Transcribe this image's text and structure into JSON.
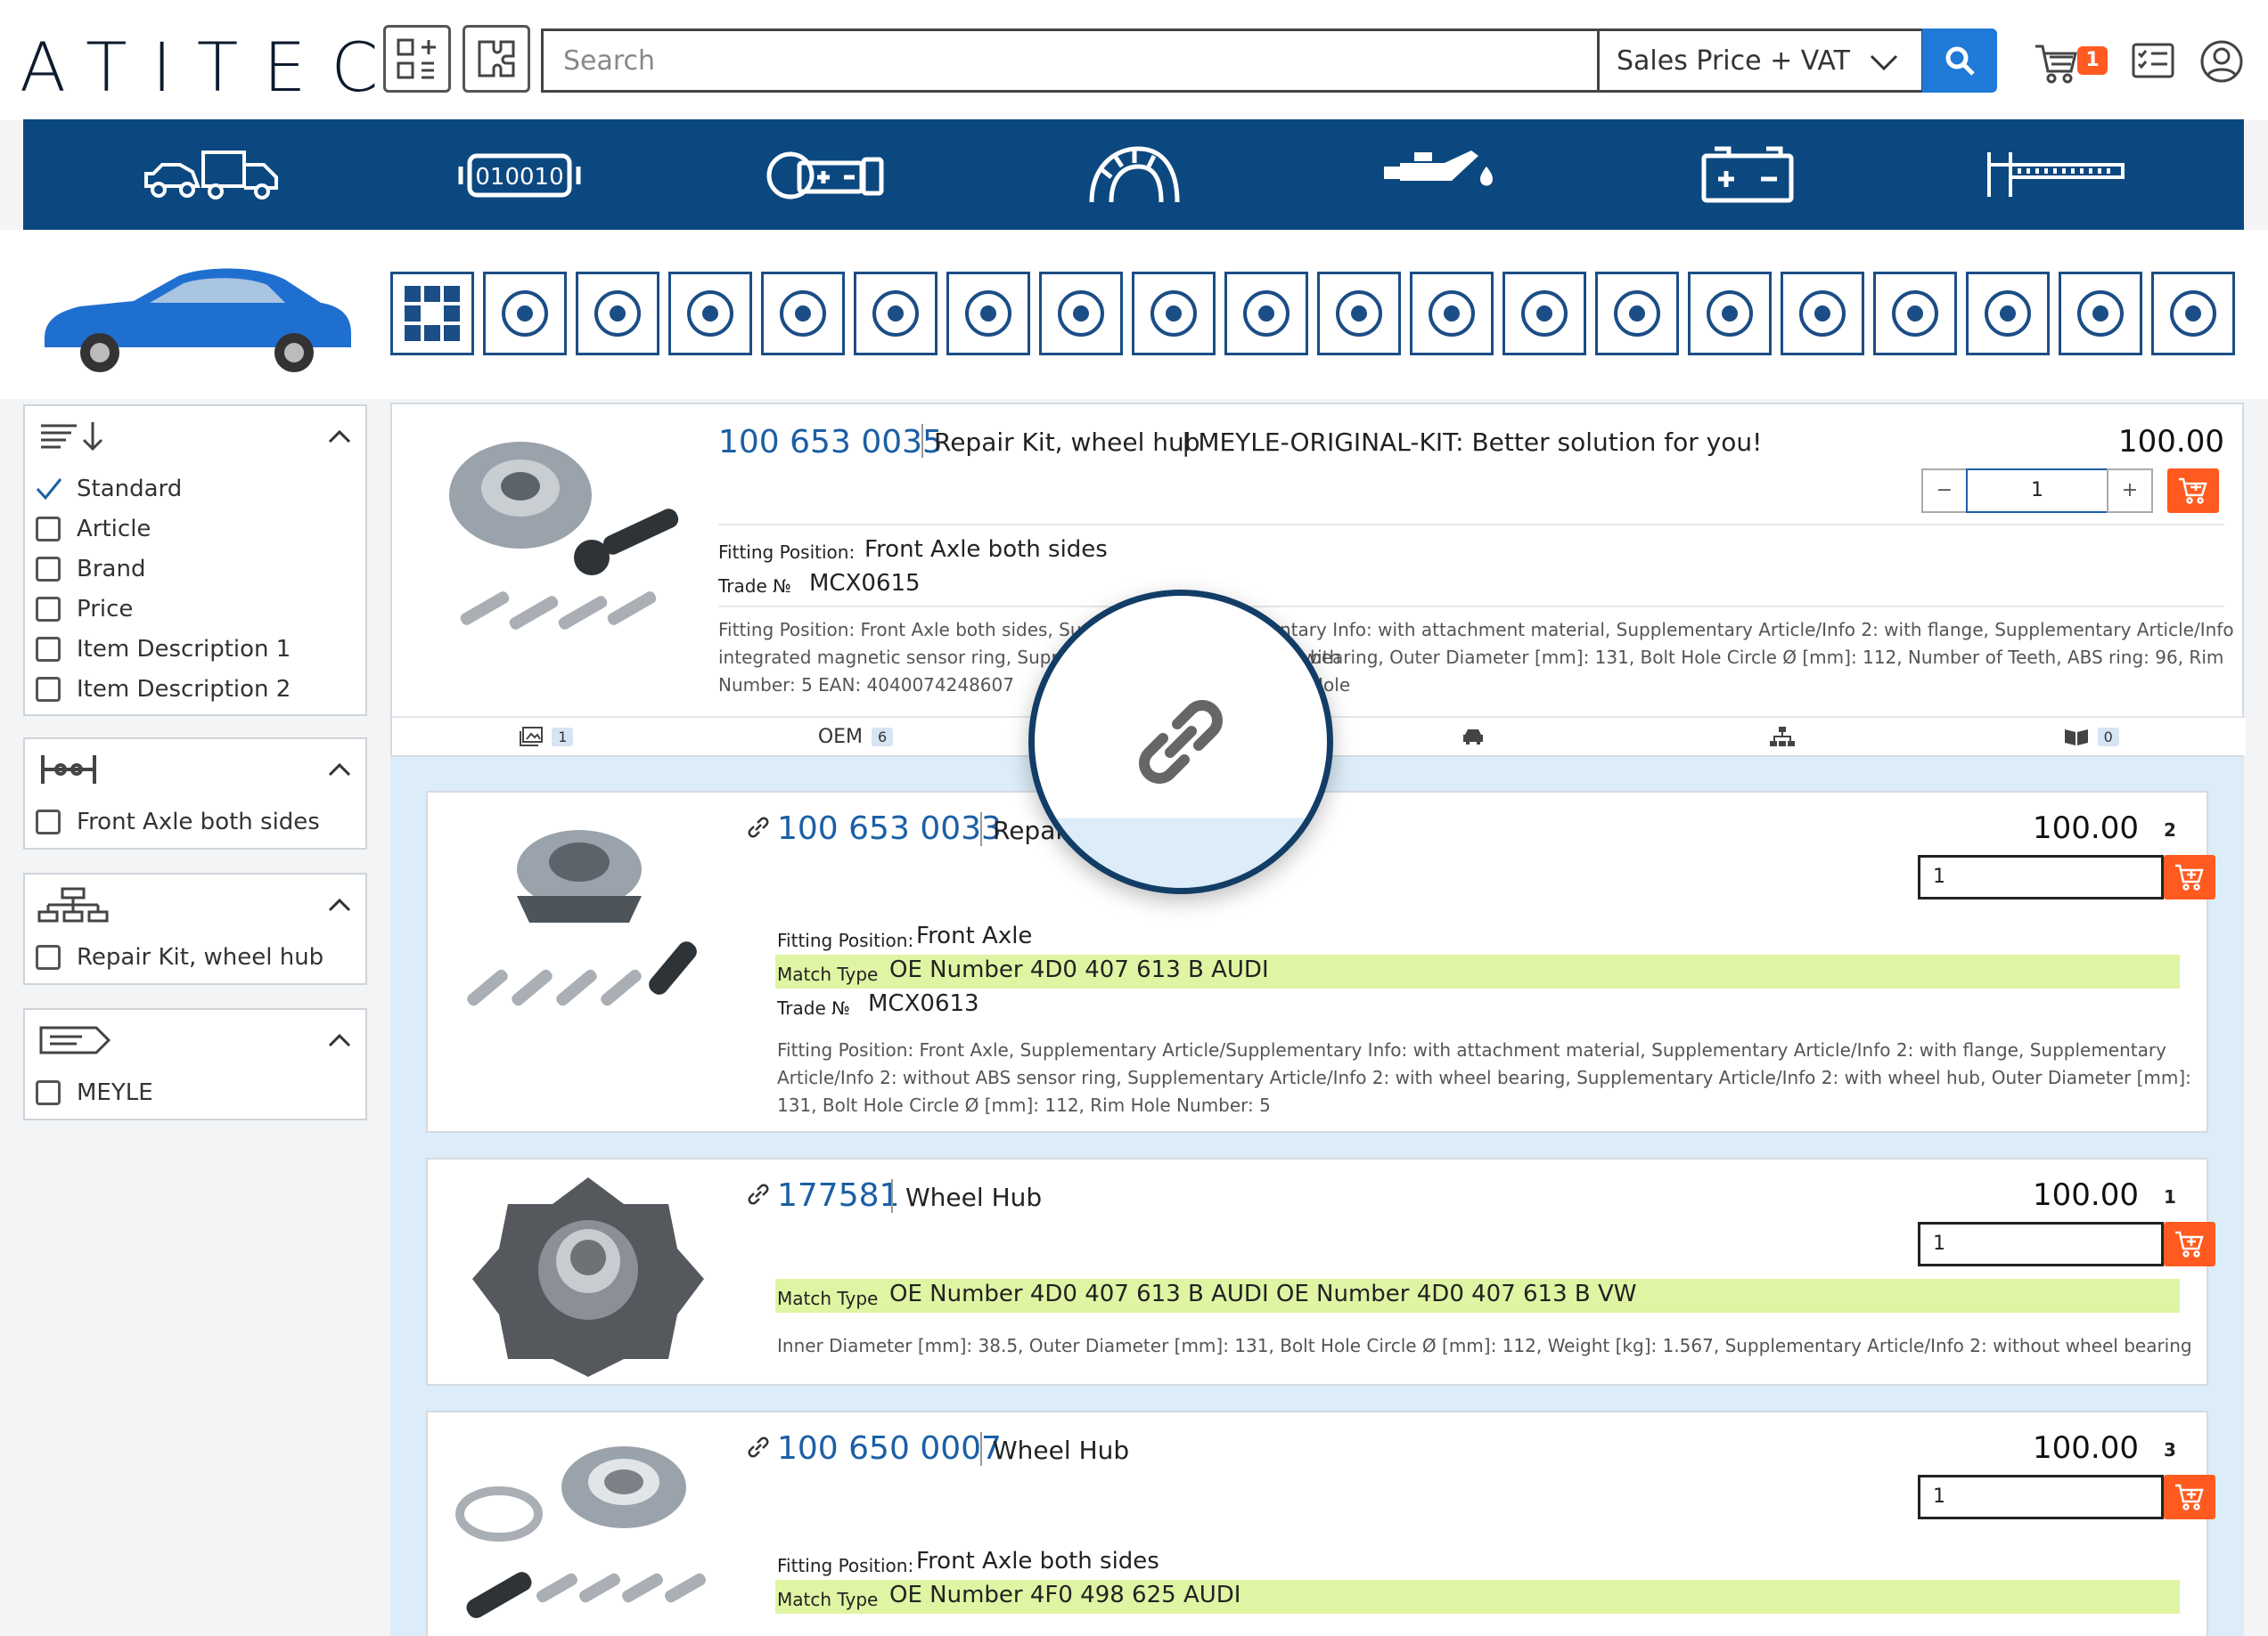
{
  "brand": {
    "logo": "ATITEC"
  },
  "header": {
    "search_placeholder": "Search",
    "price_mode": "Sales Price + VAT",
    "cart_count": "1"
  },
  "colors": {
    "brand_blue": "#0c4880",
    "accent_orange": "#ff5a1f",
    "link_blue": "#1b5fa5",
    "match_green": "#dff5a3",
    "search_blue": "#1f7ad8"
  },
  "categories": [
    "vehicles-icon",
    "engine-code-icon",
    "battery-kit-icon",
    "tyre-icon",
    "oil-can-icon",
    "battery-icon",
    "caliper-icon"
  ],
  "part_tiles": [
    "all-groups-icon",
    "body-door-icon",
    "engine-gear-icon",
    "driveshaft-icon",
    "air-filter-icon",
    "windscreen-icon",
    "fuel-can-icon",
    "axle-icon",
    "brake-disc-icon",
    "radiator-icon",
    "exhaust-icon",
    "turbo-icon",
    "steering-wheel-icon",
    "seat-icon",
    "glow-plug-icon",
    "spark-plug-icon",
    "battery-icon",
    "towbar-icon",
    "tools-icon",
    "speed-rabbit-icon"
  ],
  "filters": {
    "sort": {
      "options": [
        {
          "label": "Standard",
          "checked": true
        },
        {
          "label": "Article",
          "checked": false
        },
        {
          "label": "Brand",
          "checked": false
        },
        {
          "label": "Price",
          "checked": false
        },
        {
          "label": "Item Description 1",
          "checked": false
        },
        {
          "label": "Item Description 2",
          "checked": false
        }
      ]
    },
    "position": {
      "options": [
        {
          "label": "Front Axle both sides"
        }
      ]
    },
    "group": {
      "options": [
        {
          "label": "Repair Kit, wheel hub"
        }
      ]
    },
    "brand": {
      "options": [
        {
          "label": "MEYLE"
        }
      ]
    }
  },
  "main_article": {
    "number": "100 653 0035",
    "title": "Repair Kit, wheel hub",
    "subtitle": "| MEYLE-ORIGINAL-KIT: Better solution for you!",
    "price": "100.00",
    "qty": "1",
    "qty_minus": "−",
    "qty_plus": "+",
    "fitting_label": "Fitting Position:",
    "fitting_value": "Front Axle both sides",
    "trade_label": "Trade №",
    "trade_value": "MCX0615",
    "desc_1": "Fitting Position: Front Axle both sides, Supple",
    "desc_1b": "ntary Info: with attachment material, Supplementary Article/Info 2: with flange, Supplementary Article/Info 2: with",
    "desc_2": "integrated magnetic sensor ring, Supplem",
    "desc_2b": "bearing, Outer Diameter [mm]: 131, Bolt Hole Circle Ø [mm]: 112, Number of Teeth, ABS ring: 96, Rim Hole",
    "desc_3": "Number: 5 EAN: 4040074248607",
    "tabs": [
      {
        "label": "",
        "count": "1"
      },
      {
        "label": "OEM",
        "count": "6"
      },
      {
        "label": "",
        "count": ""
      },
      {
        "label": "",
        "count": ""
      },
      {
        "label": "",
        "count": ""
      },
      {
        "label": "",
        "count": "0"
      }
    ]
  },
  "linked": [
    {
      "number": "100 653 0033",
      "title": "Repai",
      "price": "100.00",
      "rank": "2",
      "qty": "1",
      "fitting_label": "Fitting Position:",
      "fitting_value": "Front Axle",
      "match_label": "Match Type",
      "match_value": "OE Number 4D0 407 613 B AUDI",
      "trade_label": "Trade №",
      "trade_value": "MCX0613",
      "desc": "Fitting Position: Front Axle, Supplementary Article/Supplementary Info: with attachment material, Supplementary Article/Info 2: with flange, Supplementary Article/Info 2: without ABS sensor ring, Supplementary Article/Info 2: with wheel bearing, Supplementary Article/Info 2: with wheel hub, Outer Diameter [mm]: 131, Bolt Hole Circle Ø [mm]: 112, Rim Hole Number: 5"
    },
    {
      "number": "177581",
      "title": "Wheel Hub",
      "price": "100.00",
      "rank": "1",
      "qty": "1",
      "match_label": "Match Type",
      "match_value": "OE Number 4D0 407 613 B AUDI OE Number 4D0 407 613 B VW",
      "desc": "Inner Diameter [mm]: 38.5, Outer Diameter [mm]: 131, Bolt Hole Circle Ø [mm]: 112, Weight [kg]: 1.567, Supplementary Article/Info 2: without wheel bearing"
    },
    {
      "number": "100 650 0007",
      "title": "Wheel Hub",
      "price": "100.00",
      "rank": "3",
      "qty": "1",
      "fitting_label": "Fitting Position:",
      "fitting_value": "Front Axle both sides",
      "match_label": "Match Type",
      "match_value": "OE Number 4F0 498 625 AUDI"
    }
  ]
}
